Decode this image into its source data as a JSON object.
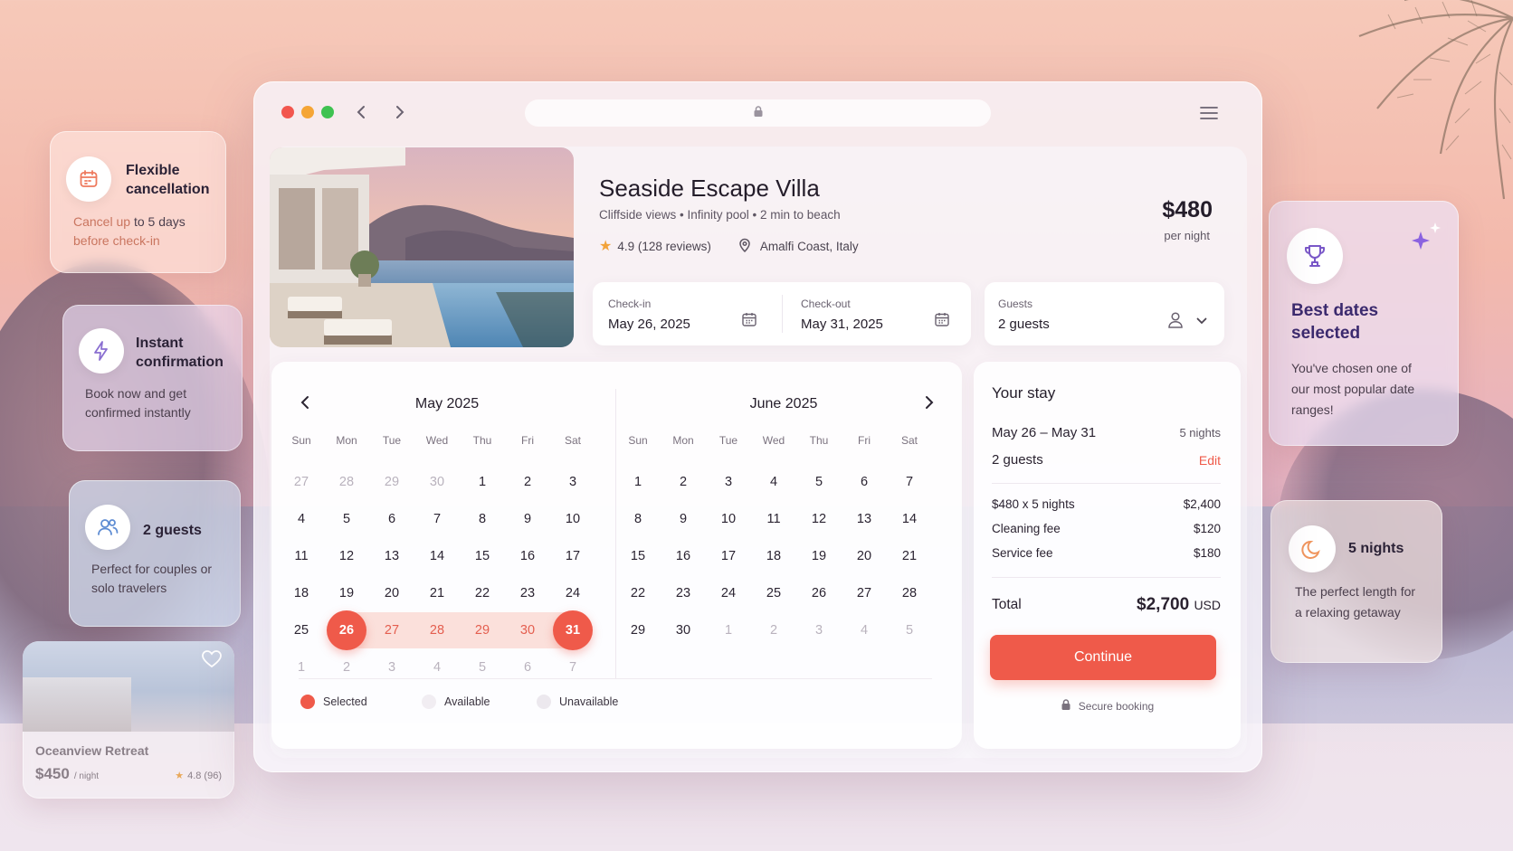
{
  "side_cards": {
    "flexible": {
      "title": "Flexible cancellation",
      "text_a": "Cancel up",
      "text_b": "to",
      "text_c": "5 days",
      "text_d": "before check-in"
    },
    "instant": {
      "title": "Instant confirmation",
      "text": "Book now and get confirmed instantly"
    },
    "guests": {
      "title": "2 guests",
      "text": "Perfect for couples or solo travelers"
    },
    "other_listing": {
      "title": "Oceanview Retreat",
      "price": "$450",
      "unit": "/ night",
      "rating": "4.8 (96)"
    },
    "best_dates": {
      "title": "Best dates selected",
      "text": "You've chosen one of our most popular date ranges!"
    },
    "nights": {
      "title": "5 nights",
      "text": "The perfect length for a relaxing getaway"
    }
  },
  "listing": {
    "title": "Seaside Escape Villa",
    "features": "Cliffside views • Infinity pool • 2 min to beach",
    "rating": "4.9 (128 reviews)",
    "location": "Amalfi Coast, Italy",
    "price": "$480",
    "price_unit": "per night"
  },
  "booking": {
    "checkin_label": "Check-in",
    "checkin_value": "May 26, 2025",
    "checkout_label": "Check-out",
    "checkout_value": "May 31, 2025",
    "guests_label": "Guests",
    "guests_value": "2 guests"
  },
  "calendar": {
    "weekdays": [
      "Sun",
      "Mon",
      "Tue",
      "Wed",
      "Thu",
      "Fri",
      "Sat"
    ],
    "months": [
      {
        "title": "May 2025",
        "days": [
          "27",
          "28",
          "29",
          "30",
          "1",
          "2",
          "3",
          "4",
          "5",
          "6",
          "7",
          "8",
          "9",
          "10",
          "11",
          "12",
          "13",
          "14",
          "15",
          "16",
          "17",
          "18",
          "19",
          "20",
          "21",
          "22",
          "23",
          "24",
          "25",
          "26",
          "27",
          "28",
          "29",
          "30",
          "31",
          "1",
          "2",
          "3",
          "4",
          "5",
          "6",
          "7"
        ],
        "leading_muted": 4,
        "trailing_muted": 7,
        "range_start": 29,
        "range_end": 34
      },
      {
        "title": "June 2025",
        "days": [
          "1",
          "2",
          "3",
          "4",
          "5",
          "6",
          "7",
          "8",
          "9",
          "10",
          "11",
          "12",
          "13",
          "14",
          "15",
          "16",
          "17",
          "18",
          "19",
          "20",
          "21",
          "22",
          "23",
          "24",
          "25",
          "26",
          "27",
          "28",
          "29",
          "30",
          "1",
          "2",
          "3",
          "4",
          "5"
        ],
        "leading_muted": 0,
        "trailing_muted": 5,
        "range_start": -1,
        "range_end": -1
      }
    ],
    "legend": {
      "selected": "Selected",
      "available": "Available",
      "unavailable": "Unavailable"
    },
    "colors": {
      "selected": "#ef5a4a",
      "range": "#fbe0db",
      "available": "#f1edf2",
      "unavailable": "#ece8ee"
    }
  },
  "summary": {
    "title": "Your stay",
    "dates": "May 26  –  May 31",
    "nights": "5 nights",
    "guests": "2 guests",
    "edit": "Edit",
    "lines": [
      {
        "label": "$480 x 5 nights",
        "value": "$2,400"
      },
      {
        "label": "Cleaning fee",
        "value": "$120"
      },
      {
        "label": "Service fee",
        "value": "$180"
      }
    ],
    "total_label": "Total",
    "total_value": "$2,700",
    "currency": "USD",
    "continue": "Continue",
    "secure": "Secure booking"
  },
  "icons": [
    "calendar-icon",
    "lightning-icon",
    "users-icon",
    "heart-icon",
    "trophy-icon",
    "sparkle-icon",
    "moon-icon",
    "lock-icon",
    "star-icon",
    "location-pin-icon",
    "user-icon",
    "chevron-down-icon",
    "chevron-left-icon",
    "chevron-right-icon",
    "menu-icon"
  ],
  "theme": {
    "accent": "#ef5a4a",
    "text": "#241d2a"
  }
}
